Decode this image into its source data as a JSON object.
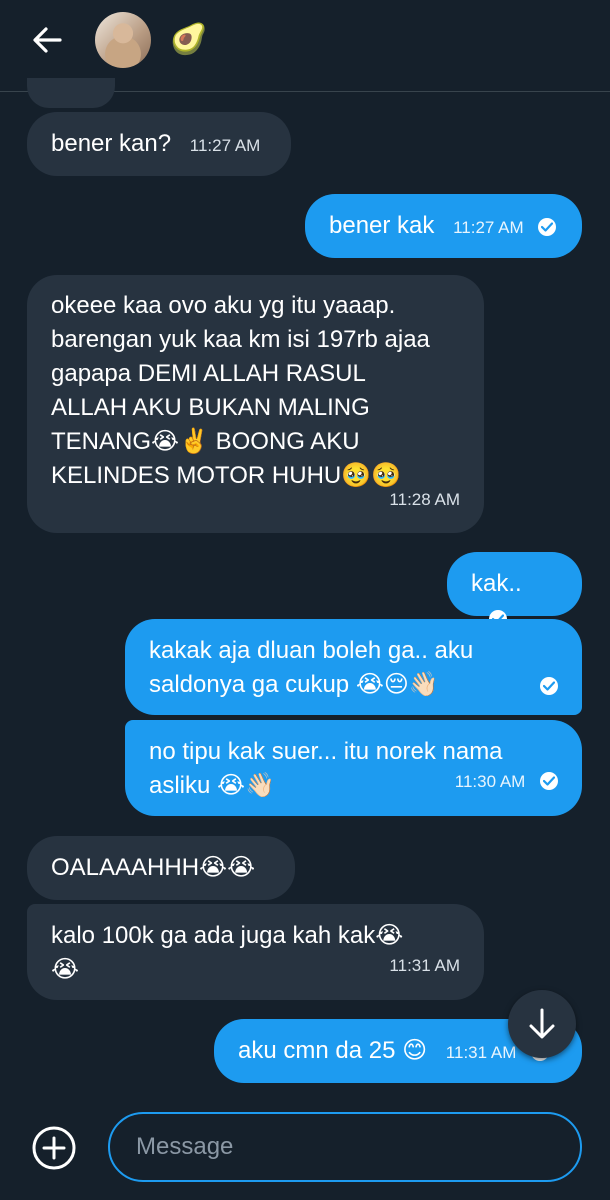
{
  "header": {
    "avatar_emoji": "🥑",
    "back_icon": "arrow-left-icon"
  },
  "messages": [
    {
      "dir": "in",
      "text": "bener kan?",
      "time": "11:27 AM"
    },
    {
      "dir": "out",
      "text": "bener kak",
      "time": "11:27 AM",
      "read": true
    },
    {
      "dir": "in",
      "text": "okeee kaa ovo aku yg itu yaaap.\nbarengan yuk kaa km isi 197rb ajaa\ngapapa DEMI ALLAH RASUL\nALLAH AKU BUKAN MALING\nTENANG😭✌️ BOONG AKU\nKELINDES MOTOR HUHU🥹🥹",
      "time": "11:28 AM"
    },
    {
      "dir": "out",
      "text": "kak..",
      "time": "",
      "read": true
    },
    {
      "dir": "out",
      "text": "kakak aja dluan boleh ga.. aku\nsaldonya ga cukup 😭😔👋🏻",
      "time": "",
      "read": true
    },
    {
      "dir": "out",
      "text": "no tipu kak suer... itu norek nama\nasliku 😭👋🏻",
      "time": "11:30 AM",
      "read": true
    },
    {
      "dir": "in",
      "text": "OALAAAHHH😭😭",
      "time": ""
    },
    {
      "dir": "in",
      "text": "kalo 100k ga ada juga kah kak😭\n😭",
      "time": "11:31 AM"
    },
    {
      "dir": "out",
      "text": "aku cmn da 25 😊",
      "time": "11:31 AM",
      "read": true
    }
  ],
  "composer": {
    "placeholder": "Message",
    "add_icon": "plus-circle-icon"
  },
  "scroll_button_icon": "arrow-down-icon",
  "colors": {
    "background": "#15202b",
    "incoming": "#273340",
    "outgoing": "#1d9bf0"
  }
}
